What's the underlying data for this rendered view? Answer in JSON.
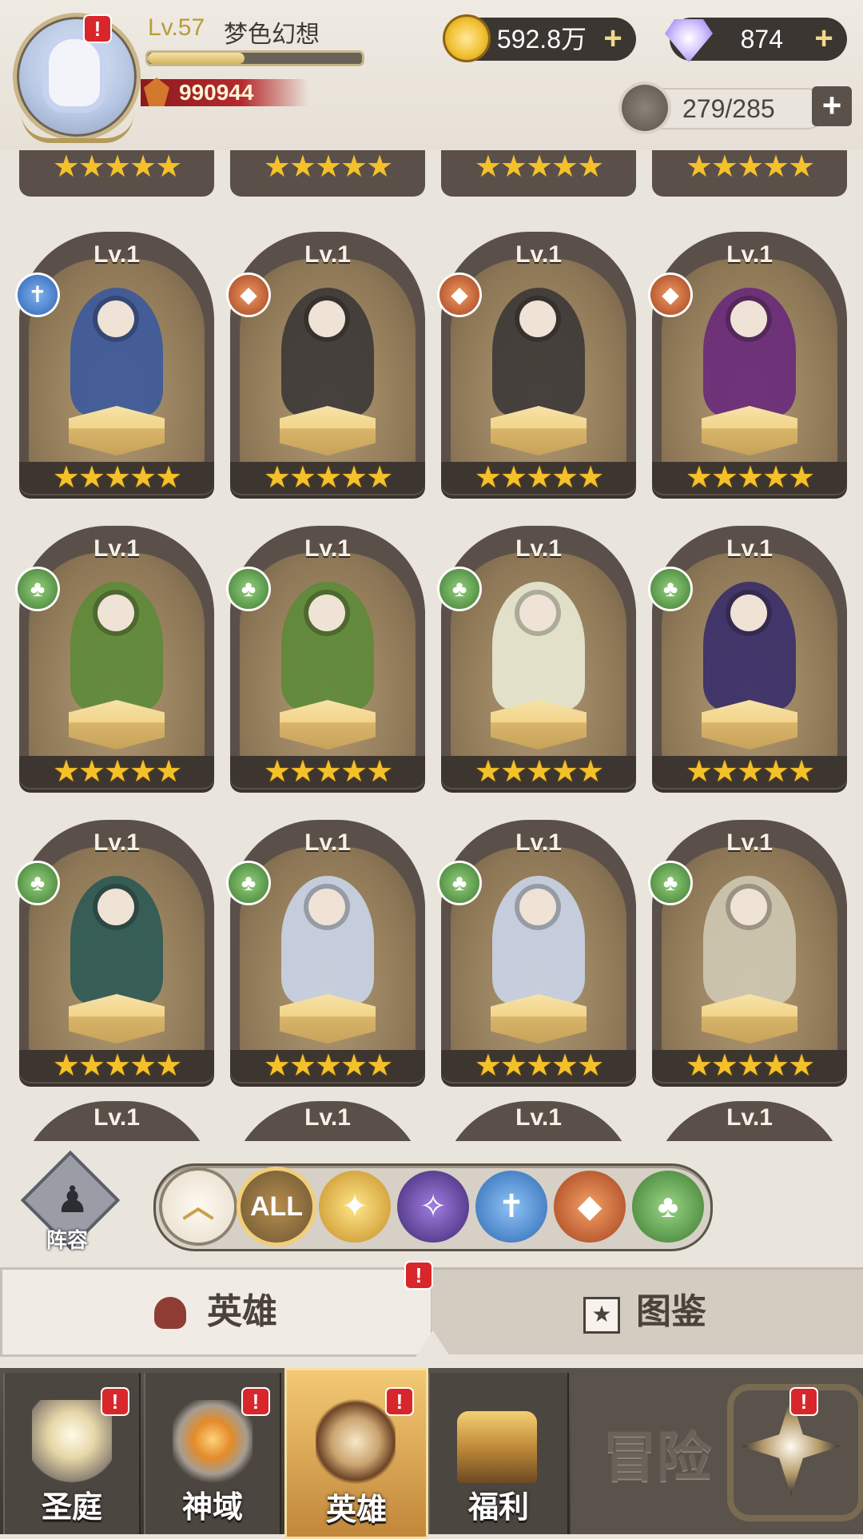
{
  "player": {
    "level_label": "Lv.57",
    "name": "梦色幻想",
    "xp_fraction": 0.45,
    "power": "990944"
  },
  "resources": {
    "gold": {
      "value": "592.8万",
      "icon": "gold-coin-icon"
    },
    "diamond": {
      "value": "874",
      "icon": "diamond-icon"
    },
    "hero_slots": {
      "value": "279/285",
      "icon": "helmet-icon"
    }
  },
  "alerts": {
    "mark": "!"
  },
  "hero_cards": [
    {
      "level": "Lv.1",
      "faction": "paladin",
      "stars": "★★★★★"
    },
    {
      "level": "Lv.1",
      "faction": "beast",
      "stars": "★★★★★"
    },
    {
      "level": "Lv.1",
      "faction": "beast",
      "stars": "★★★★★"
    },
    {
      "level": "Lv.1",
      "faction": "beast",
      "stars": "★★★★★"
    },
    {
      "level": "Lv.1",
      "faction": "forest",
      "stars": "★★★★★"
    },
    {
      "level": "Lv.1",
      "faction": "forest",
      "stars": "★★★★★"
    },
    {
      "level": "Lv.1",
      "faction": "forest",
      "stars": "★★★★★"
    },
    {
      "level": "Lv.1",
      "faction": "forest",
      "stars": "★★★★★"
    },
    {
      "level": "Lv.1",
      "faction": "forest",
      "stars": "★★★★★"
    },
    {
      "level": "Lv.1",
      "faction": "forest",
      "stars": "★★★★★"
    },
    {
      "level": "Lv.1",
      "faction": "forest",
      "stars": "★★★★★"
    },
    {
      "level": "Lv.1",
      "faction": "forest",
      "stars": "★★★★★"
    }
  ],
  "partial_top_stars": "★★★★★",
  "partial_bottom_level": "Lv.1",
  "filters": {
    "team_label": "阵容",
    "buttons": [
      {
        "name": "collapse",
        "label": "︿"
      },
      {
        "name": "all",
        "label": "ALL"
      },
      {
        "name": "light",
        "label": "✦"
      },
      {
        "name": "dark",
        "label": "✧"
      },
      {
        "name": "paladin",
        "label": "✝"
      },
      {
        "name": "beast",
        "label": "◆"
      },
      {
        "name": "forest",
        "label": "♣"
      }
    ]
  },
  "tabs": {
    "heroes": "英雄",
    "codex": "图鉴"
  },
  "nav": {
    "court": "圣庭",
    "divine": "神域",
    "heroes": "英雄",
    "welfare": "福利",
    "adventure": "冒险"
  },
  "colors": {
    "accent_gold": "#f5c12b",
    "alert_red": "#d8262a",
    "card_frame": "#5b5049"
  }
}
